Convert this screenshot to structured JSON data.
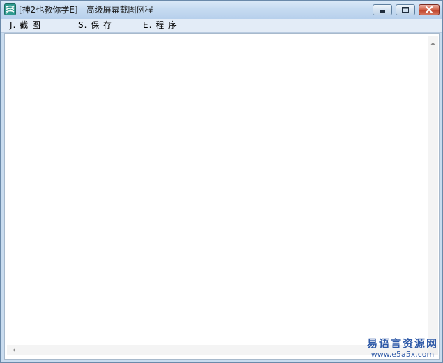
{
  "window": {
    "title": "[神2也教你学E] - 高级屏幕截图例程",
    "icon": "e-language-app-icon"
  },
  "title_controls": {
    "minimize_icon": "minimize-icon",
    "maximize_icon": "maximize-icon",
    "close_icon": "close-icon"
  },
  "menu": {
    "items": [
      {
        "label": "J. 截 图"
      },
      {
        "label": "S. 保 存"
      },
      {
        "label": "E. 程 序"
      }
    ]
  },
  "scrollbars": {
    "up_icon": "scroll-up-arrow-icon",
    "left_icon": "scroll-left-arrow-icon"
  },
  "watermark": {
    "title": "易语言资源网",
    "url": "www.e5a5x.com"
  },
  "colors": {
    "titlebar": "#c6dbf1",
    "menubar": "#e3ecf7",
    "close_button": "#c0432b",
    "watermark": "#2f5aa8"
  }
}
